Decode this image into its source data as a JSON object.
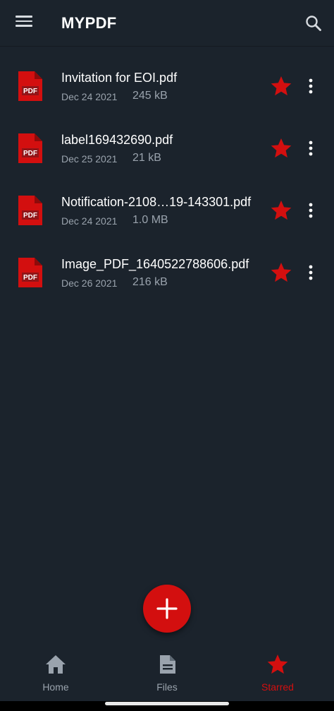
{
  "app": {
    "title_prefix": "MY",
    "title_suffix": "PDF"
  },
  "colors": {
    "background": "#1b232c",
    "accent": "#d30f0f",
    "text_secondary": "#9aa3ad",
    "nav_inactive": "#9aa3ad"
  },
  "files": [
    {
      "name": "Invitation for EOI.pdf",
      "date": "Dec 24 2021",
      "size": "245 kB",
      "starred": true
    },
    {
      "name": "label169432690.pdf",
      "date": "Dec 25 2021",
      "size": "21 kB",
      "starred": true
    },
    {
      "name": "Notification-2108…19-143301.pdf",
      "date": "Dec 24 2021",
      "size": "1.0 MB",
      "starred": true
    },
    {
      "name": "Image_PDF_1640522788606.pdf",
      "date": "Dec 26 2021",
      "size": "216 kB",
      "starred": true
    }
  ],
  "icons": {
    "file": "pdf-file-icon",
    "star": "star-icon",
    "more": "more-vert-icon",
    "menu": "menu-icon",
    "search": "search-icon",
    "add": "plus-icon"
  },
  "bottom_nav": {
    "home": "Home",
    "files": "Files",
    "starred": "Starred",
    "active": "starred"
  }
}
